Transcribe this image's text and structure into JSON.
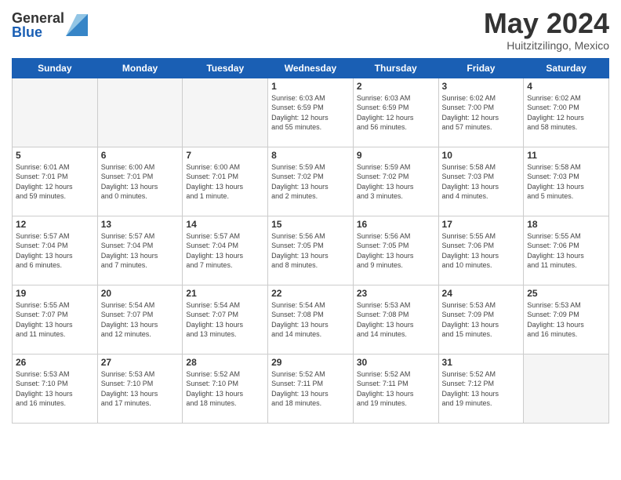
{
  "logo": {
    "general": "General",
    "blue": "Blue"
  },
  "title": "May 2024",
  "location": "Huitzitzilingo, Mexico",
  "weekdays": [
    "Sunday",
    "Monday",
    "Tuesday",
    "Wednesday",
    "Thursday",
    "Friday",
    "Saturday"
  ],
  "weeks": [
    [
      {
        "day": "",
        "info": ""
      },
      {
        "day": "",
        "info": ""
      },
      {
        "day": "",
        "info": ""
      },
      {
        "day": "1",
        "info": "Sunrise: 6:03 AM\nSunset: 6:59 PM\nDaylight: 12 hours\nand 55 minutes."
      },
      {
        "day": "2",
        "info": "Sunrise: 6:03 AM\nSunset: 6:59 PM\nDaylight: 12 hours\nand 56 minutes."
      },
      {
        "day": "3",
        "info": "Sunrise: 6:02 AM\nSunset: 7:00 PM\nDaylight: 12 hours\nand 57 minutes."
      },
      {
        "day": "4",
        "info": "Sunrise: 6:02 AM\nSunset: 7:00 PM\nDaylight: 12 hours\nand 58 minutes."
      }
    ],
    [
      {
        "day": "5",
        "info": "Sunrise: 6:01 AM\nSunset: 7:01 PM\nDaylight: 12 hours\nand 59 minutes."
      },
      {
        "day": "6",
        "info": "Sunrise: 6:00 AM\nSunset: 7:01 PM\nDaylight: 13 hours\nand 0 minutes."
      },
      {
        "day": "7",
        "info": "Sunrise: 6:00 AM\nSunset: 7:01 PM\nDaylight: 13 hours\nand 1 minute."
      },
      {
        "day": "8",
        "info": "Sunrise: 5:59 AM\nSunset: 7:02 PM\nDaylight: 13 hours\nand 2 minutes."
      },
      {
        "day": "9",
        "info": "Sunrise: 5:59 AM\nSunset: 7:02 PM\nDaylight: 13 hours\nand 3 minutes."
      },
      {
        "day": "10",
        "info": "Sunrise: 5:58 AM\nSunset: 7:03 PM\nDaylight: 13 hours\nand 4 minutes."
      },
      {
        "day": "11",
        "info": "Sunrise: 5:58 AM\nSunset: 7:03 PM\nDaylight: 13 hours\nand 5 minutes."
      }
    ],
    [
      {
        "day": "12",
        "info": "Sunrise: 5:57 AM\nSunset: 7:04 PM\nDaylight: 13 hours\nand 6 minutes."
      },
      {
        "day": "13",
        "info": "Sunrise: 5:57 AM\nSunset: 7:04 PM\nDaylight: 13 hours\nand 7 minutes."
      },
      {
        "day": "14",
        "info": "Sunrise: 5:57 AM\nSunset: 7:04 PM\nDaylight: 13 hours\nand 7 minutes."
      },
      {
        "day": "15",
        "info": "Sunrise: 5:56 AM\nSunset: 7:05 PM\nDaylight: 13 hours\nand 8 minutes."
      },
      {
        "day": "16",
        "info": "Sunrise: 5:56 AM\nSunset: 7:05 PM\nDaylight: 13 hours\nand 9 minutes."
      },
      {
        "day": "17",
        "info": "Sunrise: 5:55 AM\nSunset: 7:06 PM\nDaylight: 13 hours\nand 10 minutes."
      },
      {
        "day": "18",
        "info": "Sunrise: 5:55 AM\nSunset: 7:06 PM\nDaylight: 13 hours\nand 11 minutes."
      }
    ],
    [
      {
        "day": "19",
        "info": "Sunrise: 5:55 AM\nSunset: 7:07 PM\nDaylight: 13 hours\nand 11 minutes."
      },
      {
        "day": "20",
        "info": "Sunrise: 5:54 AM\nSunset: 7:07 PM\nDaylight: 13 hours\nand 12 minutes."
      },
      {
        "day": "21",
        "info": "Sunrise: 5:54 AM\nSunset: 7:07 PM\nDaylight: 13 hours\nand 13 minutes."
      },
      {
        "day": "22",
        "info": "Sunrise: 5:54 AM\nSunset: 7:08 PM\nDaylight: 13 hours\nand 14 minutes."
      },
      {
        "day": "23",
        "info": "Sunrise: 5:53 AM\nSunset: 7:08 PM\nDaylight: 13 hours\nand 14 minutes."
      },
      {
        "day": "24",
        "info": "Sunrise: 5:53 AM\nSunset: 7:09 PM\nDaylight: 13 hours\nand 15 minutes."
      },
      {
        "day": "25",
        "info": "Sunrise: 5:53 AM\nSunset: 7:09 PM\nDaylight: 13 hours\nand 16 minutes."
      }
    ],
    [
      {
        "day": "26",
        "info": "Sunrise: 5:53 AM\nSunset: 7:10 PM\nDaylight: 13 hours\nand 16 minutes."
      },
      {
        "day": "27",
        "info": "Sunrise: 5:53 AM\nSunset: 7:10 PM\nDaylight: 13 hours\nand 17 minutes."
      },
      {
        "day": "28",
        "info": "Sunrise: 5:52 AM\nSunset: 7:10 PM\nDaylight: 13 hours\nand 18 minutes."
      },
      {
        "day": "29",
        "info": "Sunrise: 5:52 AM\nSunset: 7:11 PM\nDaylight: 13 hours\nand 18 minutes."
      },
      {
        "day": "30",
        "info": "Sunrise: 5:52 AM\nSunset: 7:11 PM\nDaylight: 13 hours\nand 19 minutes."
      },
      {
        "day": "31",
        "info": "Sunrise: 5:52 AM\nSunset: 7:12 PM\nDaylight: 13 hours\nand 19 minutes."
      },
      {
        "day": "",
        "info": ""
      }
    ]
  ]
}
